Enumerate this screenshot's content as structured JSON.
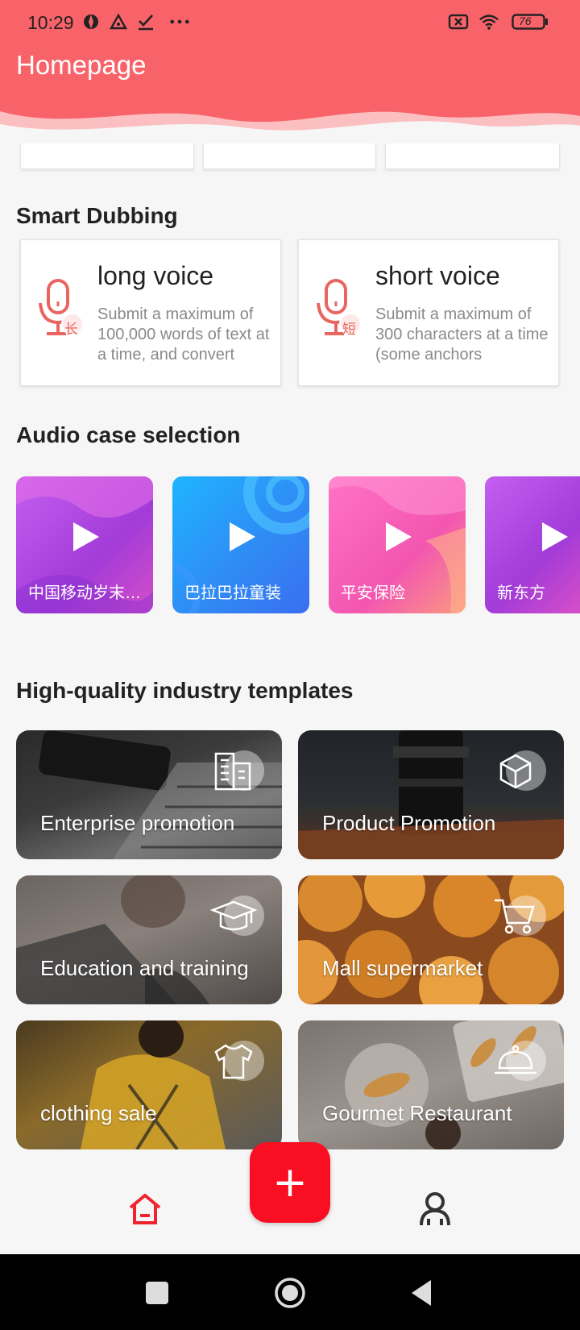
{
  "status_bar": {
    "time": "10:29",
    "battery": "76"
  },
  "header": {
    "title": "Homepage",
    "color": "#f8636a"
  },
  "smart_dubbing": {
    "title": "Smart Dubbing",
    "cards": [
      {
        "title": "long voice",
        "badge": "长",
        "description": "Submit a maximum of 100,000 words of text at a time, and convert"
      },
      {
        "title": "short voice",
        "badge": "短",
        "description": "Submit a maximum of 300 characters at a time (some anchors"
      }
    ]
  },
  "audio_cases": {
    "title": "Audio case selection",
    "items": [
      {
        "label": "中国移动岁末…"
      },
      {
        "label": "巴拉巴拉童装"
      },
      {
        "label": "平安保险"
      },
      {
        "label": "新东方"
      }
    ]
  },
  "templates": {
    "title": "High-quality industry templates",
    "items": [
      {
        "label": "Enterprise promotion",
        "icon": "building-icon"
      },
      {
        "label": "Product Promotion",
        "icon": "cube-icon"
      },
      {
        "label": "Education and training",
        "icon": "graduation-cap-icon"
      },
      {
        "label": "Mall supermarket",
        "icon": "cart-icon"
      },
      {
        "label": "clothing sale",
        "icon": "shirt-icon"
      },
      {
        "label": "Gourmet Restaurant",
        "icon": "cloche-icon"
      }
    ]
  },
  "bottom_nav": {
    "fab_label": "+",
    "accent": "#fa0f22"
  }
}
